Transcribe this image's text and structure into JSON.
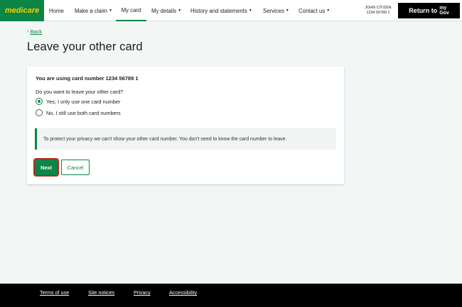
{
  "header": {
    "logo": "medicare",
    "nav": [
      {
        "label": "Home",
        "dropdown": false
      },
      {
        "label": "Make a claim",
        "dropdown": true
      },
      {
        "label": "My card",
        "dropdown": false,
        "active": true
      },
      {
        "label": "My details",
        "dropdown": true
      },
      {
        "label": "History and statements",
        "dropdown": true
      },
      {
        "label": "Services",
        "dropdown": true
      },
      {
        "label": "Contact us",
        "dropdown": true
      }
    ],
    "user_name": "JOHN CITIZEN",
    "user_number": "1234 56789 1",
    "return_label": "Return to",
    "mygov_my": "my",
    "mygov_gov": "Gov"
  },
  "page": {
    "back_label": "Back",
    "title": "Leave your other card"
  },
  "card": {
    "heading": "You are using card number 1234 56789 1",
    "question": "Do you want to leave your other card?",
    "options": [
      {
        "label": "Yes, I only use one card number",
        "checked": true
      },
      {
        "label": "No, I still use both card numbers",
        "checked": false
      }
    ],
    "info_text": "To protect your privacy we can't show your other card number. You don't need to know the card number to leave.",
    "next_label": "Next",
    "cancel_label": "Cancel"
  },
  "footer": {
    "links": [
      "Terms of use",
      "Site notices",
      "Privacy",
      "Accessibility"
    ]
  },
  "colors": {
    "brand_green": "#0c8546",
    "logo_yellow": "#f4d100",
    "focus_red": "#b3271c"
  },
  "icons": {
    "dropdown": "chevron-down-icon",
    "back": "chevron-left-icon"
  }
}
